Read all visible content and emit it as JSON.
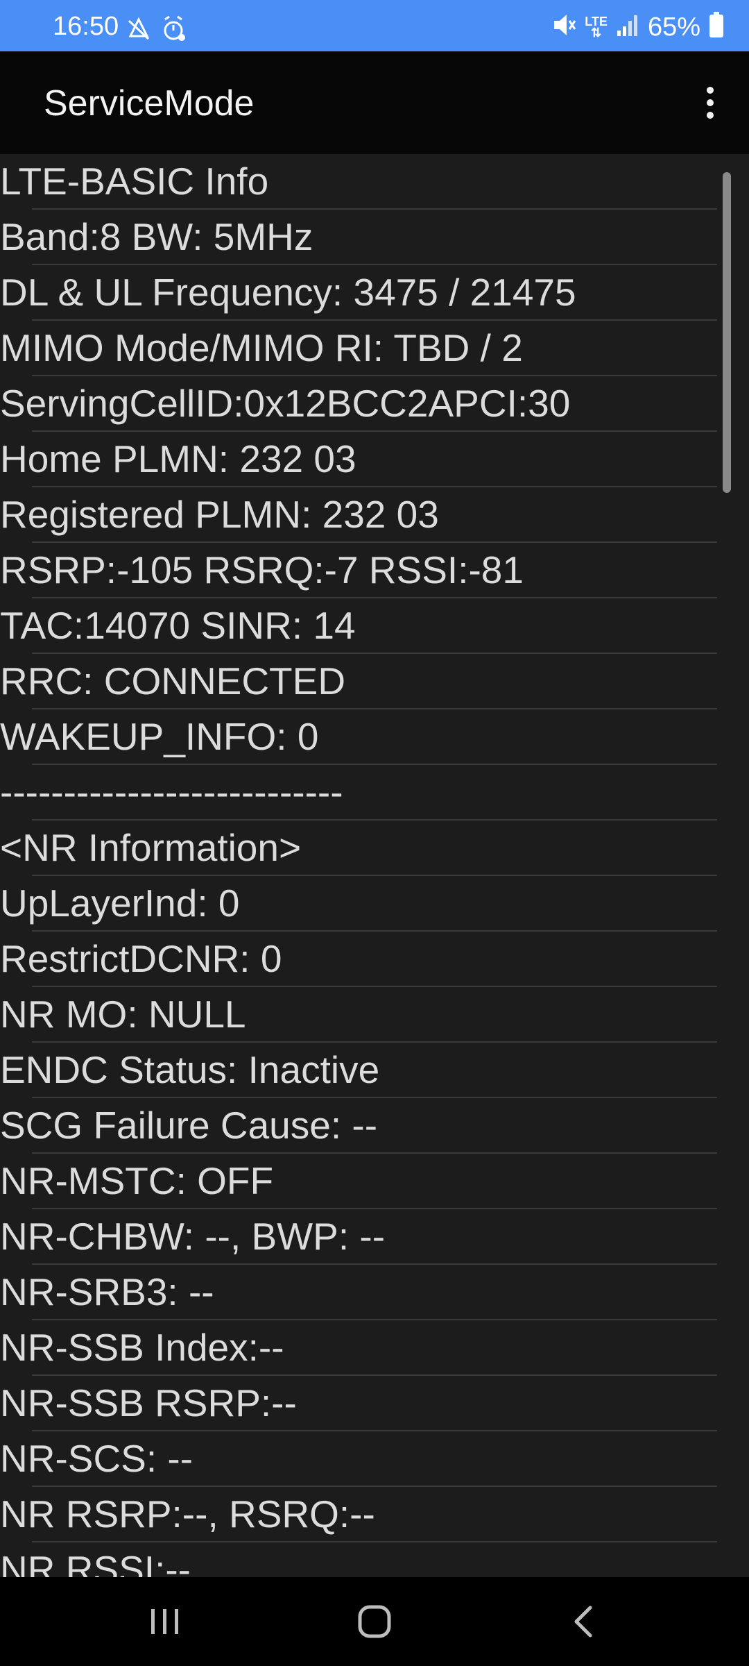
{
  "status_bar": {
    "time": "16:50",
    "battery_percent": "65%",
    "network_type": "LTE",
    "left_icons": [
      "no-sim-alert-icon",
      "alarm-settings-icon"
    ],
    "right_icons": [
      "mute-icon",
      "lte-data-icon",
      "signal-strength-icon",
      "battery-icon"
    ]
  },
  "app_bar": {
    "title": "ServiceMode",
    "menu_icon": "overflow-menu-icon"
  },
  "list": {
    "items": [
      "LTE-BASIC Info",
      "Band:8 BW: 5MHz",
      "DL & UL Frequency: 3475 / 21475",
      "MIMO Mode/MIMO RI: TBD / 2",
      "ServingCellID:0x12BCC2APCI:30",
      "Home PLMN: 232 03",
      "Registered PLMN: 232 03",
      "RSRP:-105 RSRQ:-7 RSSI:-81",
      "TAC:14070 SINR: 14",
      "RRC: CONNECTED",
      "WAKEUP_INFO: 0",
      "---------------------------",
      "<NR Information>",
      "UpLayerInd: 0",
      "RestrictDCNR: 0",
      "NR MO: NULL",
      "ENDC Status: Inactive",
      "SCG Failure Cause: --",
      "NR-MSTC: OFF",
      "NR-CHBW: --, BWP: --",
      "NR-SRB3: --",
      "NR-SSB Index:--",
      "NR-SSB RSRP:--",
      "NR-SCS: --",
      "NR RSRP:--, RSRQ:--",
      "NR RSSI:--"
    ]
  },
  "nav_bar": {
    "icons": [
      "recent-apps-icon",
      "home-icon",
      "back-icon"
    ]
  },
  "colors": {
    "status_bar_bg": "#4a8ff5",
    "app_bar_bg": "#060606",
    "content_bg": "#1c1c1c",
    "text": "#dcdcdc",
    "divider": "#3a3a3a"
  }
}
